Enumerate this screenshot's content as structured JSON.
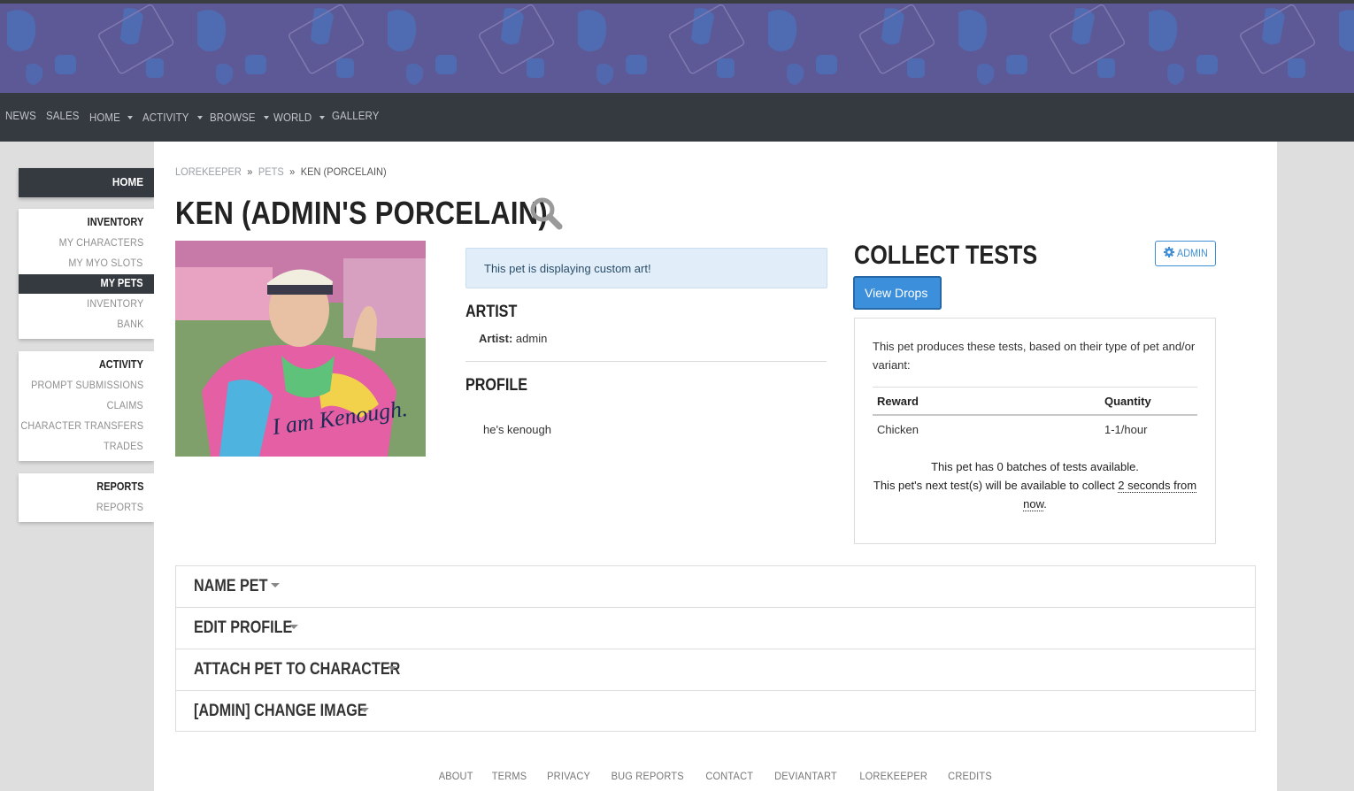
{
  "nav": {
    "items": [
      {
        "label": "NEWS",
        "dropdown": false
      },
      {
        "label": "SALES",
        "dropdown": false
      },
      {
        "label": "HOME",
        "dropdown": true
      },
      {
        "label": "ACTIVITY",
        "dropdown": true
      },
      {
        "label": "BROWSE",
        "dropdown": true
      },
      {
        "label": "WORLD",
        "dropdown": true
      },
      {
        "label": "GALLERY",
        "dropdown": false
      }
    ]
  },
  "sidebar": {
    "home": "HOME",
    "inventory": {
      "heading": "INVENTORY",
      "links": [
        "MY CHARACTERS",
        "MY MYO SLOTS",
        "MY PETS",
        "INVENTORY",
        "BANK"
      ],
      "active": "MY PETS"
    },
    "activity": {
      "heading": "ACTIVITY",
      "links": [
        "PROMPT SUBMISSIONS",
        "CLAIMS",
        "CHARACTER TRANSFERS",
        "TRADES"
      ]
    },
    "reports": {
      "heading": "REPORTS",
      "links": [
        "REPORTS"
      ]
    }
  },
  "breadcrumb": [
    "LOREKEEPER",
    "PETS",
    "KEN (PORCELAIN)"
  ],
  "page_title": "KEN (ADMIN'S PORCELAIN)",
  "title_icon": "search-icon",
  "pet_image": {
    "caption_text": "I am Kenough."
  },
  "alert": "This pet is displaying custom art!",
  "artist": {
    "heading": "ARTIST",
    "label": "Artist:",
    "value": "admin"
  },
  "profile": {
    "heading": "PROFILE",
    "text": "he's kenough"
  },
  "collect": {
    "title": "COLLECT TESTS",
    "admin_button": "ADMIN",
    "view_drops_button": "View Drops",
    "intro": "This pet produces these tests, based on their type of pet and/or variant:",
    "table": {
      "headers": [
        "Reward",
        "Quantity"
      ],
      "rows": [
        [
          "Chicken",
          "1-1/hour"
        ]
      ]
    },
    "batches_line": "This pet has 0 batches of tests available.",
    "next_prefix": "This pet's next test(s) will be available to collect",
    "next_time_a": "2 seconds from",
    "next_time_b": "now",
    "next_suffix": "."
  },
  "accordion": [
    "NAME PET",
    "EDIT PROFILE",
    "ATTACH PET TO CHARACTER",
    "[ADMIN] CHANGE IMAGE"
  ],
  "footer": [
    "ABOUT",
    "TERMS",
    "PRIVACY",
    "BUG REPORTS",
    "CONTACT",
    "DEVIANTART",
    "LOREKEEPER",
    "CREDITS"
  ],
  "colors": {
    "banner": "#5d5896",
    "navbar": "#343a40",
    "primary": "#3b8fdb",
    "alert_bg": "#e1eef9"
  }
}
